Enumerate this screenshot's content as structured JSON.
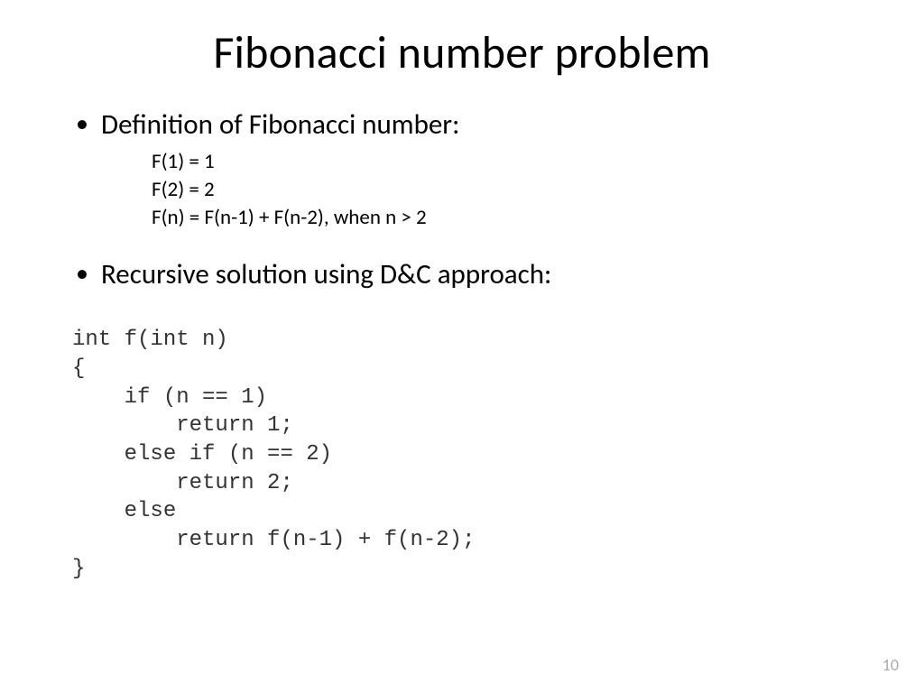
{
  "title": "Fibonacci number problem",
  "bullets": {
    "definition_label": "Definition of Fibonacci number:",
    "recursive_label": "Recursive solution using D&C approach:"
  },
  "definition_lines": {
    "l1": "F(1) = 1",
    "l2": "F(2) = 2",
    "l3": "F(n) = F(n-1) + F(n-2), when n > 2"
  },
  "code_lines": {
    "c0": "int f(int n)",
    "c1": "{",
    "c2": "    if (n == 1)",
    "c3": "        return 1;",
    "c4": "    else if (n == 2)",
    "c5": "        return 2;",
    "c6": "    else",
    "c7": "        return f(n-1) + f(n-2);",
    "c8": "}"
  },
  "page_number": "10"
}
